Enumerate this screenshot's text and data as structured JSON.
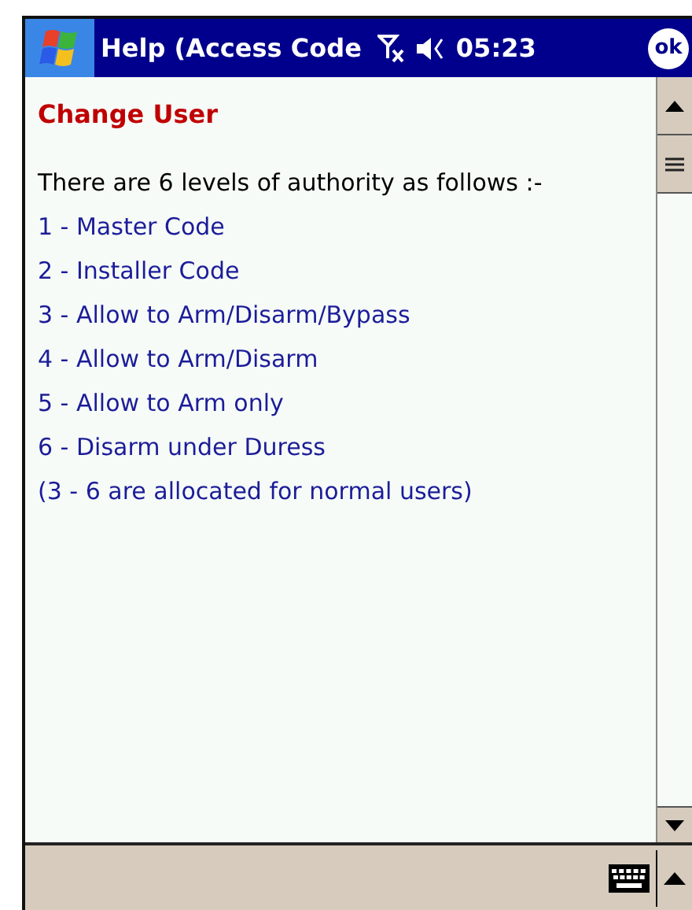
{
  "title_bar": {
    "title": "Help (Access Code",
    "time": "05:23",
    "ok_button": "ok"
  },
  "content": {
    "heading": "Change User",
    "intro": "There are 6 levels of authority as follows :-",
    "levels": [
      "1 - Master Code",
      "2 - Installer Code",
      "3 - Allow to Arm/Disarm/Bypass",
      "4 - Allow to Arm/Disarm",
      "5 - Allow to Arm only",
      "6 - Disarm under Duress"
    ],
    "note": "(3 - 6 are allocated for normal users)"
  }
}
